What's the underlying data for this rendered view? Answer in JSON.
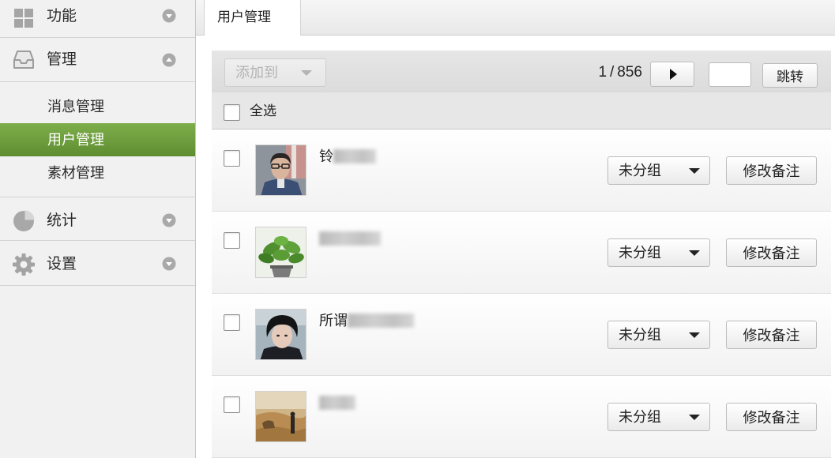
{
  "sidebar": {
    "sections": [
      {
        "label": "功能",
        "icon": "grid-icon",
        "toggle_icon": "chevron-down-icon",
        "expanded": false
      },
      {
        "label": "管理",
        "icon": "inbox-icon",
        "toggle_icon": "chevron-up-icon",
        "expanded": true,
        "items": [
          {
            "label": "消息管理",
            "active": false
          },
          {
            "label": "用户管理",
            "active": true
          },
          {
            "label": "素材管理",
            "active": false
          }
        ]
      },
      {
        "label": "统计",
        "icon": "pie-chart-icon",
        "toggle_icon": "chevron-down-icon",
        "expanded": false
      },
      {
        "label": "设置",
        "icon": "gear-icon",
        "toggle_icon": "chevron-down-icon",
        "expanded": false
      }
    ]
  },
  "tabs": [
    {
      "label": "用户管理",
      "active": true
    }
  ],
  "toolbar": {
    "add_to": {
      "label": "添加到",
      "disabled": true
    },
    "pager": {
      "current": "1",
      "separator": "/",
      "total": "856"
    },
    "jump_input": {
      "value": ""
    },
    "jump_button": {
      "label": "跳转"
    }
  },
  "select_all": {
    "label": "全选",
    "checked": false
  },
  "users": [
    {
      "name": "铃",
      "name_obscured": true,
      "checked": false,
      "group": "未分组",
      "remark_button": "修改备注"
    },
    {
      "name": "",
      "name_obscured": true,
      "checked": false,
      "group": "未分组",
      "remark_button": "修改备注"
    },
    {
      "name": "所谓",
      "name_obscured": true,
      "checked": false,
      "group": "未分组",
      "remark_button": "修改备注"
    },
    {
      "name": "",
      "name_obscured": true,
      "checked": false,
      "group": "未分组",
      "remark_button": "修改备注"
    }
  ],
  "colors": {
    "accent": "#6a9a3a",
    "sidebar_bg": "#f1f1f1",
    "toolbar_bg": "#e0e0e0",
    "disabled_text": "#b3b3b3"
  }
}
